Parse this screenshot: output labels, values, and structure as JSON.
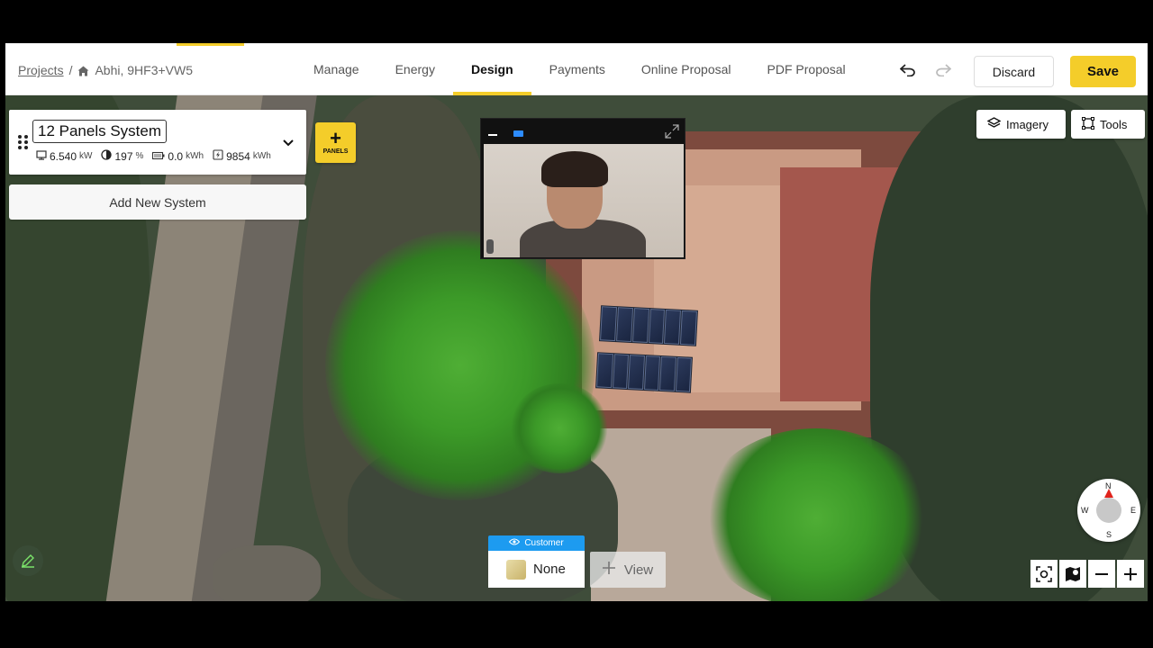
{
  "header": {
    "breadcrumb": {
      "projects": "Projects",
      "separator": "/",
      "project_name": "Abhi, 9HF3+VW5",
      "home_icon": "home-icon"
    },
    "tabs": [
      {
        "label": "Manage",
        "active": false
      },
      {
        "label": "Energy",
        "active": false
      },
      {
        "label": "Design",
        "active": true
      },
      {
        "label": "Payments",
        "active": false
      },
      {
        "label": "Online Proposal",
        "active": false
      },
      {
        "label": "PDF Proposal",
        "active": false
      }
    ],
    "undo_icon": "undo-icon",
    "redo_icon": "redo-icon",
    "discard_label": "Discard",
    "save_label": "Save",
    "accent_color": "#f4cd2a"
  },
  "system": {
    "name": "12 Panels System",
    "capacity_value": "6.540",
    "capacity_unit": "kW",
    "offset_value": "197",
    "offset_unit": "%",
    "battery_value": "0.0",
    "battery_unit": "kWh",
    "production_value": "9854",
    "production_unit": "kWh",
    "add_system_label": "Add New System",
    "panels_button_label": "PANELS"
  },
  "map_controls": {
    "imagery_label": "Imagery",
    "tools_label": "Tools",
    "compass": {
      "n": "N",
      "e": "E",
      "s": "S",
      "w": "W"
    }
  },
  "customer": {
    "tag_label": "Customer",
    "value": "None",
    "view_label": "View"
  }
}
